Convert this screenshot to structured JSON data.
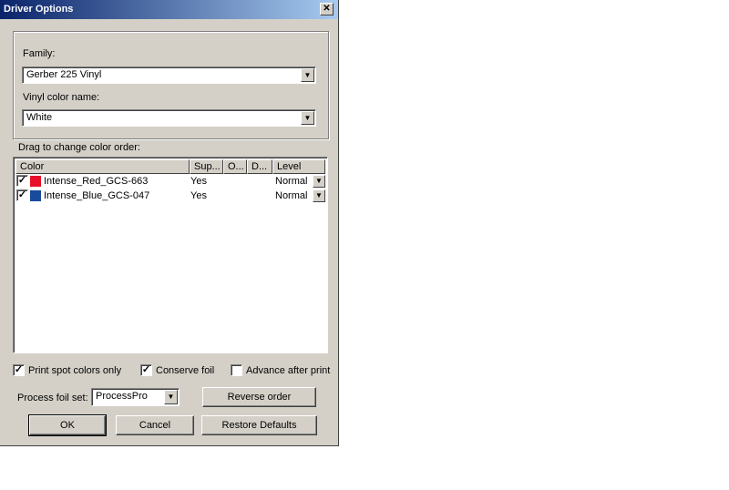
{
  "window": {
    "title": "Driver Options",
    "close_glyph": "✕"
  },
  "family": {
    "label": "Family:",
    "value": "Gerber 225 Vinyl"
  },
  "vinyl": {
    "label": "Vinyl color name:",
    "value": "White"
  },
  "list": {
    "caption": "Drag to change color order:",
    "columns": [
      "Color",
      "Sup...",
      "O...",
      "D...",
      "Level"
    ],
    "rows": [
      {
        "checked": true,
        "color": "#e8102a",
        "name": "Intense_Red_GCS-663",
        "support": "Yes",
        "level": "Normal"
      },
      {
        "checked": true,
        "color": "#1a4a9c",
        "name": "Intense_Blue_GCS-047",
        "support": "Yes",
        "level": "Normal"
      }
    ]
  },
  "options": {
    "print_spot": {
      "label": "Print spot colors only",
      "checked": true
    },
    "conserve_foil": {
      "label": "Conserve foil",
      "checked": true
    },
    "advance": {
      "label": "Advance after print",
      "checked": false
    }
  },
  "process_foil": {
    "label": "Process foil set:",
    "value": "ProcessPro"
  },
  "buttons": {
    "reverse": "Reverse order",
    "ok": "OK",
    "cancel": "Cancel",
    "restore": "Restore Defaults"
  },
  "icons": {
    "check": "✓",
    "dropdown": "▼"
  }
}
